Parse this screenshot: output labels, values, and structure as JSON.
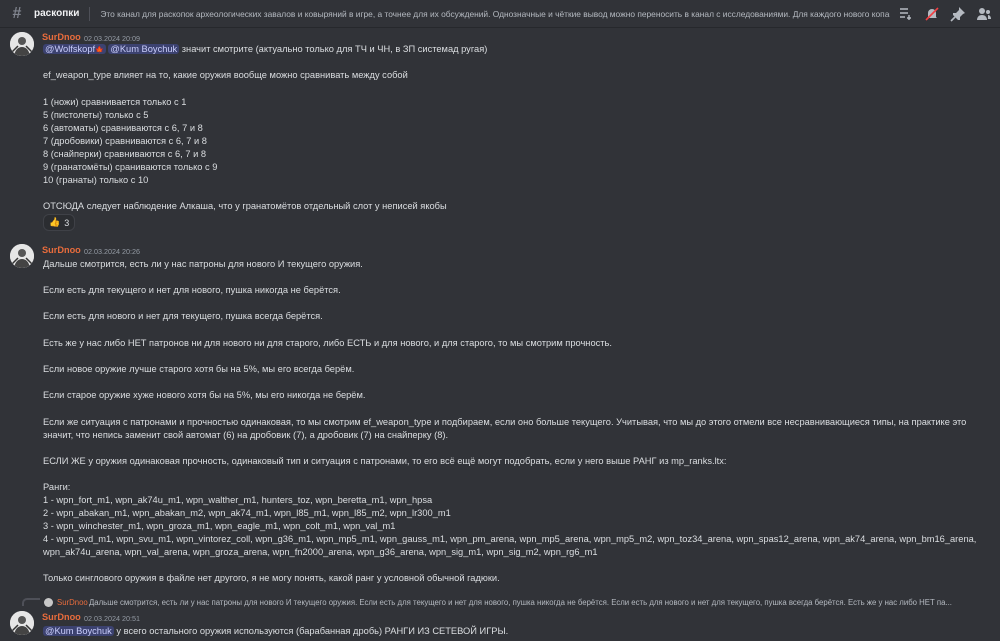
{
  "channel": {
    "name": "раскопки",
    "topic": "Это канал для раскопок археологических завалов и ковыряний в игре, а точнее для их обсуждений. Однозначные и чёткие вывод можно переносить в канал с исследованиями. Для каждого нового копания желатель..."
  },
  "header_icons": [
    "threads-icon",
    "mute-bell-icon",
    "pin-icon",
    "members-icon"
  ],
  "messages": [
    {
      "author": "SurDnoo",
      "timestamp": "02.03.2024 20:09",
      "first_line": {
        "mention1": "@Wolfskopf",
        "mention1_emoji": "🍁",
        "mention2": "@Kum Boychuk",
        "text": "значит смотрите (актуально только для ТЧ и ЧН, в ЗП системад ругая)"
      },
      "lines": [
        "ef_weapon_type влияет на то, какие оружия вообще можно сравнивать между собой",
        "1 (ножи) сравнивается только с 1",
        "5 (пистолеты) только с 5",
        "6 (автоматы) сравниваются с 6, 7 и 8",
        "7 (дробовики) сравниваются с 6, 7 и 8",
        "8 (снайперки) сравниваются с 6, 7 и 8",
        "9 (гранатомёты) сраниваются только с 9",
        "10 (гранаты) только с  10",
        "ОТСЮДА следует наблюдение Алкаша, что у гранатомётов отдельный слот у неписей якобы"
      ],
      "reaction": {
        "emoji": "👍",
        "count": "3"
      }
    },
    {
      "author": "SurDnoo",
      "timestamp": "02.03.2024 20:26",
      "lines": [
        "Дальше смотрится, есть ли у нас патроны для нового И текущего оружия.",
        "Если есть для текущего и нет для нового, пушка никогда не берётся.",
        "Если есть для нового и нет для текущего, пушка всегда берётся.",
        "Есть же у нас либо НЕТ патронов ни для нового ни для старого, либо ЕСТЬ и для нового, и для старого, то мы смотрим прочность.",
        "Если новое оружие лучше старого хотя бы на 5%, мы его всегда берём.",
        "Если старое оружие хуже нового хотя бы на 5%, мы его никогда не берём.",
        "Если же ситуация с патронами и прочностью одинаковая, то мы смотрим ef_weapon_type и подбираем, если оно больше текущего. Учитывая, что мы до этого отмели все несравнивающиеся типы, на практике это",
        "значит, что непись заменит свой автомат (6) на дробовик (7), а дробовик (7) на снайперку (8).",
        "ЕСЛИ ЖЕ у оружия одинаковая прочность, одинаковый тип и ситуация с патронами,  то его всё ещё могут подобрать, если у него выше РАНГ из mp_ranks.ltx:",
        "Ранги:",
        "1 - wpn_fort_m1, wpn_ak74u_m1, wpn_walther_m1, hunters_toz, wpn_beretta_m1, wpn_hpsa",
        "2 - wpn_abakan_m1, wpn_abakan_m2, wpn_ak74_m1, wpn_l85_m1, wpn_l85_m2, wpn_lr300_m1",
        "3 - wpn_winchester_m1, wpn_groza_m1, wpn_eagle_m1, wpn_colt_m1, wpn_val_m1",
        "4 - wpn_svd_m1, wpn_svu_m1, wpn_vintorez_coll, wpn_g36_m1, wpn_mp5_m1, wpn_gauss_m1, wpn_pm_arena, wpn_mp5_arena, wpn_mp5_m2, wpn_toz34_arena, wpn_spas12_arena, wpn_ak74_arena, wpn_bm16_arena,",
        "wpn_ak74u_arena, wpn_val_arena, wpn_groza_arena, wpn_fn2000_arena, wpn_g36_arena, wpn_sig_m1, wpn_sig_m2, wpn_rg6_m1",
        "Только синглового оружия в файле нет другого, я не могу понять, какой ранг у условной обычной гадюки."
      ]
    },
    {
      "reply": {
        "author": "SurDnoo",
        "text": "Дальше смотрится, есть ли у нас патроны для нового И текущего оружия.  Если есть для текущего и нет для нового, пушка никогда не берётся.  Если есть для нового и нет для текущего, пушка всегда берётся.  Есть же у нас либо НЕТ па..."
      },
      "author": "SurDnoo",
      "timestamp": "02.03.2024 20:51",
      "mention": "@Kum Boychuk",
      "text": "у всего остального оружия используются (барабанная дробь) РАНГИ ИЗ СЕТЕВОЙ ИГРЫ."
    }
  ]
}
